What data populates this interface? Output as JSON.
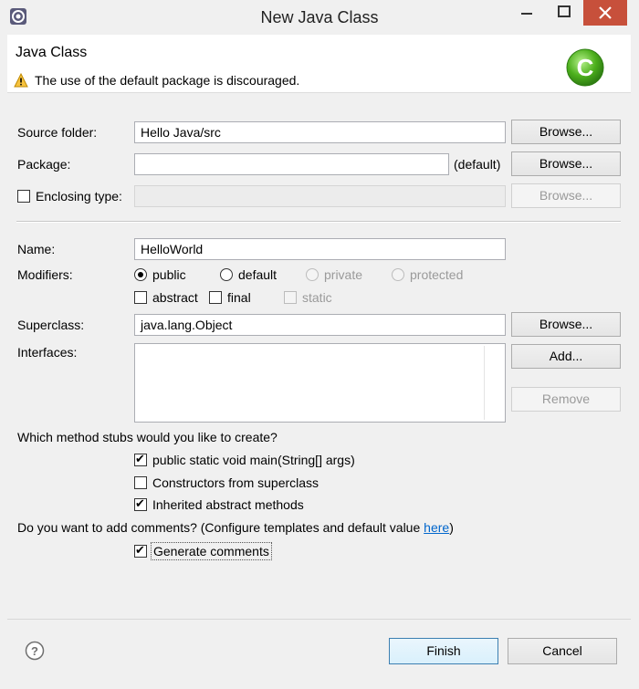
{
  "window": {
    "title": "New Java Class"
  },
  "header": {
    "title": "Java Class",
    "message": "The use of the default package is discouraged."
  },
  "form": {
    "source_folder": {
      "label": "Source folder:",
      "value": "Hello Java/src",
      "browse": "Browse..."
    },
    "package": {
      "label": "Package:",
      "value": "",
      "suffix": "(default)",
      "browse": "Browse..."
    },
    "enclosing_type": {
      "label": "Enclosing type:",
      "value": "",
      "browse": "Browse..."
    },
    "name": {
      "label": "Name:",
      "value": "HelloWorld"
    },
    "modifiers": {
      "label": "Modifiers:",
      "public": "public",
      "default": "default",
      "private": "private",
      "protected": "protected",
      "abstract": "abstract",
      "final": "final",
      "static": "static"
    },
    "superclass": {
      "label": "Superclass:",
      "value": "java.lang.Object",
      "browse": "Browse..."
    },
    "interfaces": {
      "label": "Interfaces:",
      "add": "Add...",
      "remove": "Remove"
    },
    "stubs": {
      "question": "Which method stubs would you like to create?",
      "main": "public static void main(String[] args)",
      "constructors": "Constructors from superclass",
      "inherited": "Inherited abstract methods"
    },
    "comments": {
      "question_prefix": "Do you want to add comments? (Configure templates and default value ",
      "link": "here",
      "question_suffix": ")",
      "generate": "Generate comments"
    }
  },
  "footer": {
    "finish": "Finish",
    "cancel": "Cancel"
  },
  "colors": {
    "close_button": "#c7503b",
    "logo_green": "#4caf1c",
    "link": "#0066cc"
  }
}
